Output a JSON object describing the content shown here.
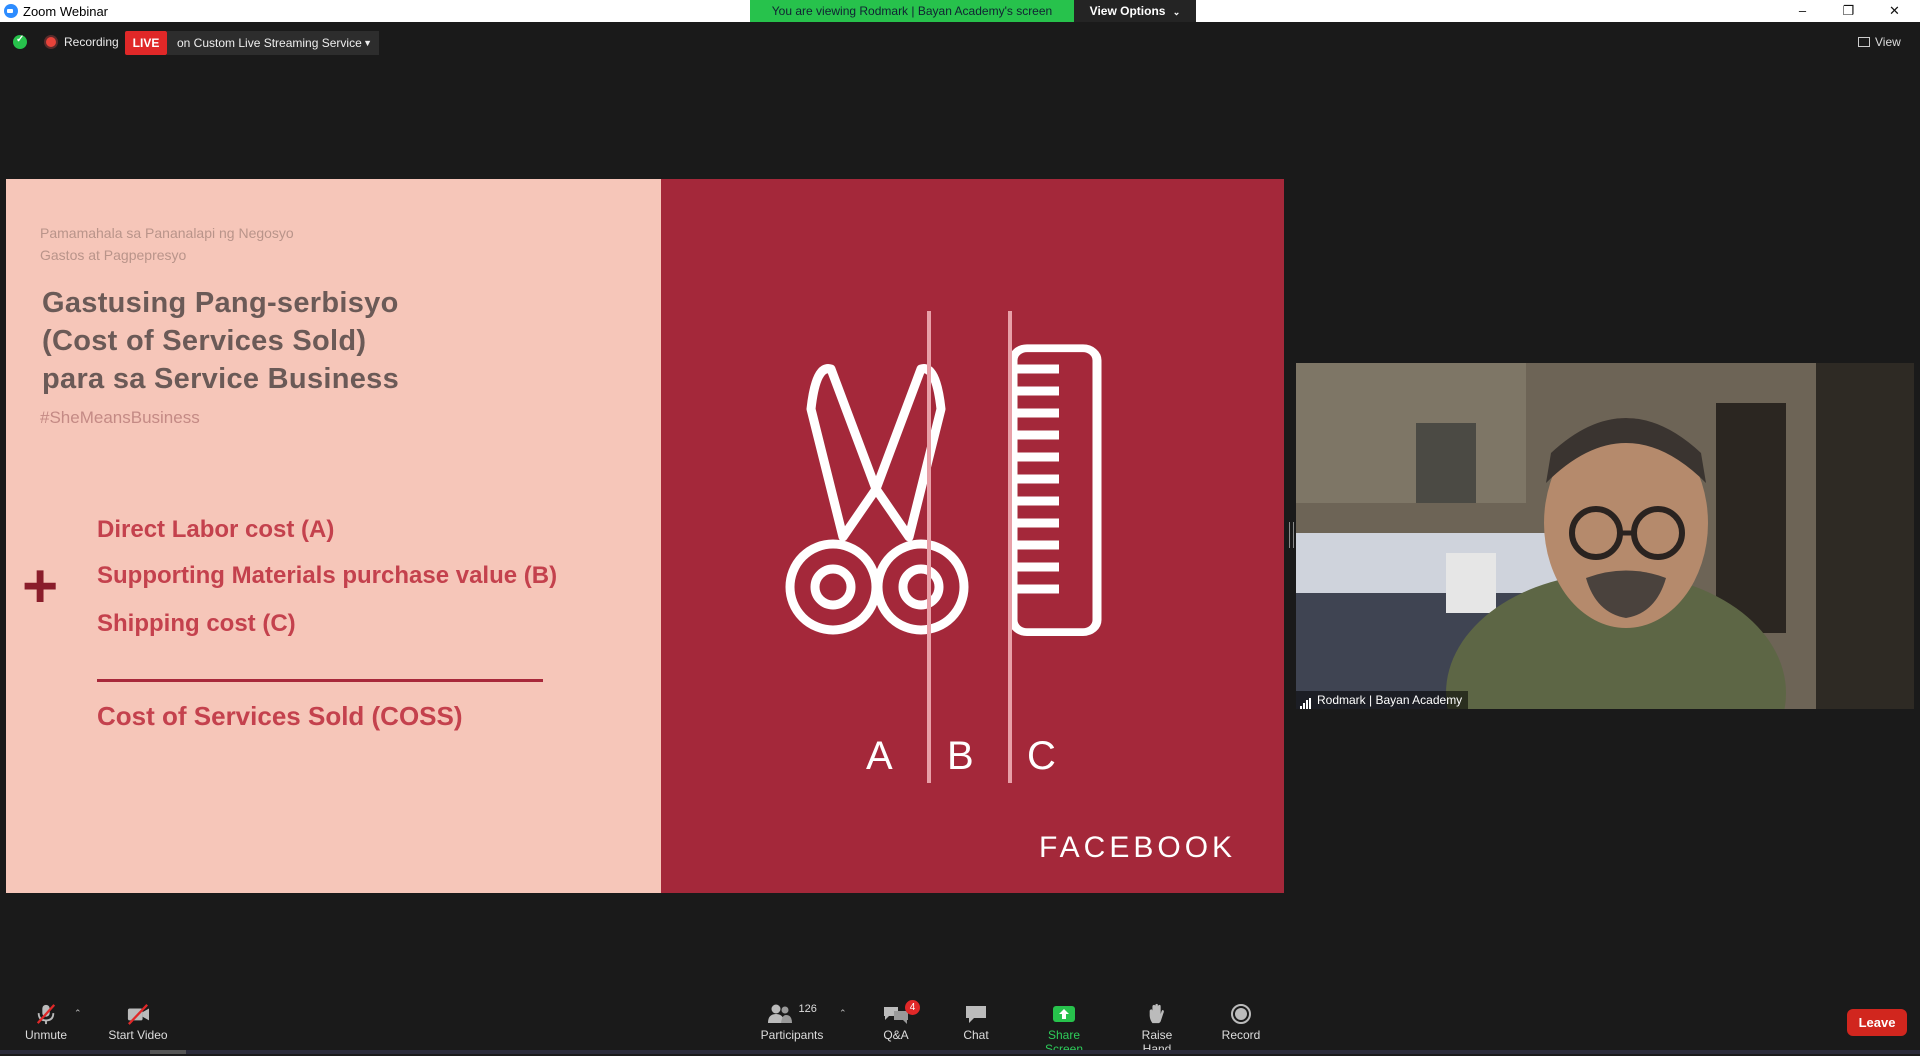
{
  "window": {
    "title": "Zoom Webinar",
    "viewing_banner": "You are viewing Rodmark | Bayan Academy's screen",
    "view_options": "View Options",
    "controls": [
      "–",
      "❐",
      "✕"
    ]
  },
  "top_bar": {
    "recording_label": "Recording",
    "live_label": "LIVE",
    "stream_select": "on Custom Live Streaming Service",
    "view_label": "View"
  },
  "slide": {
    "subtitle_1": "Pamamahala sa Pananalapi ng Negosyo",
    "subtitle_2": "Gastos at Pagpepresyo",
    "title_1": "Gastusing Pang-serbisyo",
    "title_2": "(Cost of Services Sold)",
    "title_3": "para sa  Service Business",
    "hashtag": "#SheMeansBusiness",
    "plus": "+",
    "items": [
      "Direct Labor cost (A)",
      "Supporting Materials purchase value (B)",
      "Shipping cost (C)"
    ],
    "result": "Cost of Services Sold (COSS)",
    "letters": [
      "A",
      "B",
      "C"
    ],
    "brand": "FACEBOOK"
  },
  "video": {
    "participant_name": "Rodmark | Bayan Academy"
  },
  "toolbar": {
    "unmute": "Unmute",
    "start_video": "Start Video",
    "participants": "Participants",
    "participants_count": "126",
    "qa": "Q&A",
    "qa_badge": "4",
    "chat": "Chat",
    "share_screen": "Share Screen",
    "raise_hand": "Raise Hand",
    "record": "Record",
    "leave": "Leave"
  },
  "colors": {
    "accent_green": "#27c24c",
    "live_red": "#e02828",
    "slide_pink": "#f6c6b9",
    "slide_red": "#a4283a"
  }
}
